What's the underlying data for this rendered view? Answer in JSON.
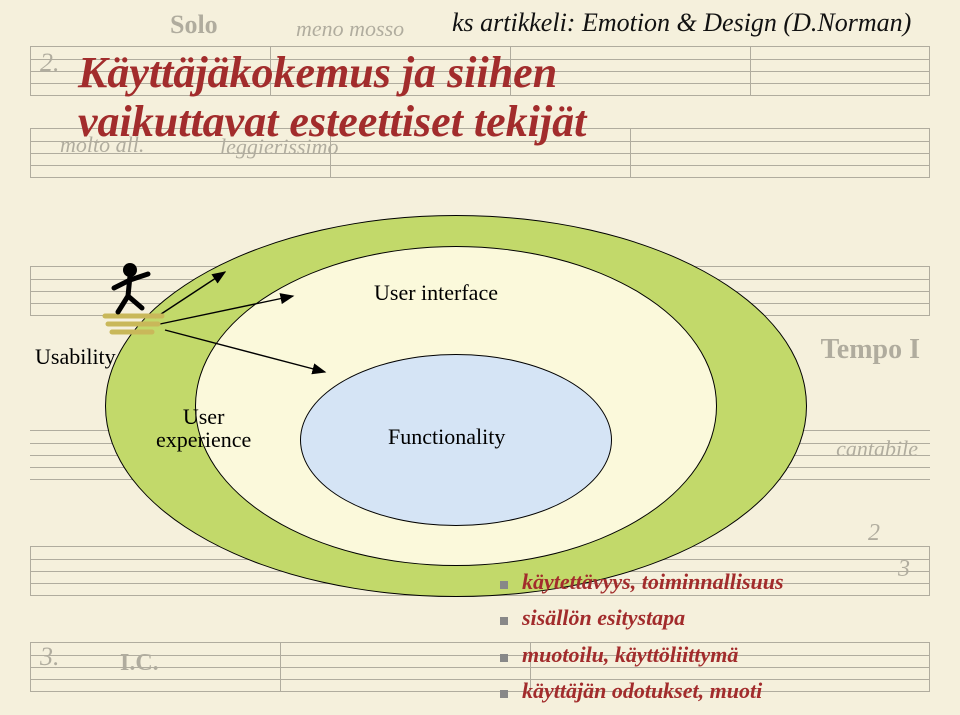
{
  "header": {
    "subtitle": "ks artikkeli: Emotion & Design (D.Norman)",
    "title_line1": "Käyttäjäkokemus ja siihen",
    "title_line2": "vaikuttavat esteettiset tekijät"
  },
  "diagram": {
    "user_interface": "User interface",
    "functionality": "Functionality",
    "usability": "Usability",
    "user_experience_line1": "User",
    "user_experience_line2": "experience"
  },
  "bullets": [
    "käytettävyys, toiminnallisuus",
    "sisällön esitystapa",
    "muotoilu, käyttöliittymä",
    "käyttäjän odotukset, muoti"
  ],
  "music_markings": {
    "solo": "Solo",
    "meno_mosso": "meno mosso",
    "moltoall": "molto all.",
    "leggier": "leggierissimo",
    "tempo1": "Tempo I",
    "cantabile": "cantabile",
    "num2a": "2.",
    "num3a": "3.",
    "num2b": "2",
    "num3b": "3",
    "ic": "I.C."
  },
  "chart_data": {
    "type": "venn-nested",
    "title": "Käyttäjäkokemus ja siihen vaikuttavat esteettiset tekijät",
    "subtitle": "ks artikkeli: Emotion & Design (D.Norman)",
    "levels": [
      {
        "name": "User experience",
        "contains": [
          "User interface"
        ]
      },
      {
        "name": "User interface",
        "contains": [
          "Functionality"
        ]
      },
      {
        "name": "Functionality",
        "contains": []
      }
    ],
    "external_label": "Usability",
    "arrows": [
      {
        "from": "Usability",
        "to": "User experience"
      },
      {
        "from": "Usability",
        "to": "User interface"
      },
      {
        "from": "Usability",
        "to": "Functionality"
      }
    ],
    "bullets": [
      "käytettävyys, toiminnallisuus",
      "sisällön esitystapa",
      "muotoilu, käyttöliittymä",
      "käyttäjän odotukset, muoti"
    ]
  }
}
